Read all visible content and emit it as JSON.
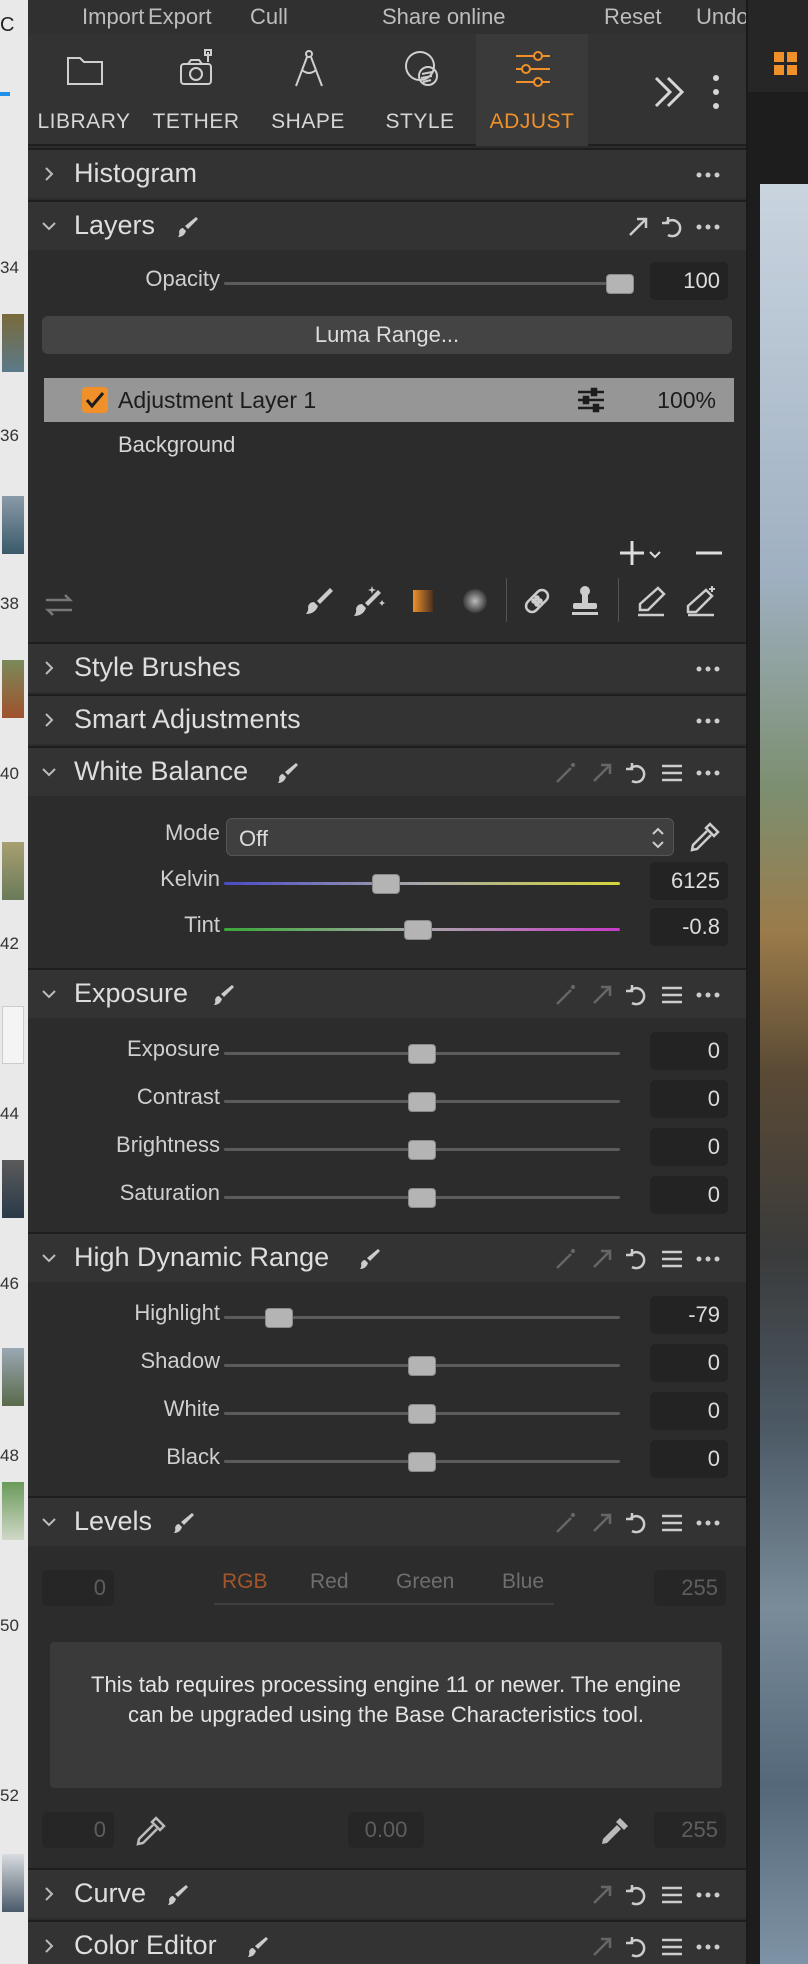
{
  "menu": {
    "import": "Import",
    "export": "Export",
    "cull": "Cull",
    "share": "Share online",
    "reset": "Reset",
    "undo": "Undo/Redo"
  },
  "tabs": [
    {
      "label": "LIBRARY",
      "icon": "folder-icon"
    },
    {
      "label": "TETHER",
      "icon": "camera-icon"
    },
    {
      "label": "SHAPE",
      "icon": "compass-icon"
    },
    {
      "label": "STYLE",
      "icon": "style-circle-icon"
    },
    {
      "label": "ADJUST",
      "icon": "sliders-icon",
      "active": true
    }
  ],
  "accent_color": "#f0902a",
  "filmstrip": {
    "letter": "C",
    "numbers": [
      "34",
      "36",
      "38",
      "40",
      "42",
      "44",
      "46",
      "48",
      "50",
      "52"
    ]
  },
  "histogram": {
    "title": "Histogram"
  },
  "layers": {
    "title": "Layers",
    "opacity_label": "Opacity",
    "opacity_value": "100",
    "opacity_fraction": 1.0,
    "luma_button": "Luma Range...",
    "active_layer": {
      "name": "Adjustment Layer 1",
      "opacity": "100%",
      "checked": true
    },
    "background_layer": "Background"
  },
  "style_brushes": {
    "title": "Style Brushes"
  },
  "smart_adjustments": {
    "title": "Smart Adjustments"
  },
  "white_balance": {
    "title": "White Balance",
    "mode_label": "Mode",
    "mode_value": "Off",
    "kelvin_label": "Kelvin",
    "kelvin_value": "6125",
    "kelvin_fraction": 0.41,
    "tint_label": "Tint",
    "tint_value": "-0.8",
    "tint_fraction": 0.49
  },
  "exposure": {
    "title": "Exposure",
    "rows": [
      {
        "label": "Exposure",
        "value": "0",
        "fraction": 0.5
      },
      {
        "label": "Contrast",
        "value": "0",
        "fraction": 0.5
      },
      {
        "label": "Brightness",
        "value": "0",
        "fraction": 0.5
      },
      {
        "label": "Saturation",
        "value": "0",
        "fraction": 0.5
      }
    ]
  },
  "hdr": {
    "title": "High Dynamic Range",
    "rows": [
      {
        "label": "Highlight",
        "value": "-79",
        "fraction": 0.14
      },
      {
        "label": "Shadow",
        "value": "0",
        "fraction": 0.5
      },
      {
        "label": "White",
        "value": "0",
        "fraction": 0.5
      },
      {
        "label": "Black",
        "value": "0",
        "fraction": 0.5
      }
    ]
  },
  "levels": {
    "title": "Levels",
    "input_low": "0",
    "input_high": "255",
    "channels": [
      "RGB",
      "Red",
      "Green",
      "Blue"
    ],
    "notice": "This tab requires processing engine 11 or newer. The engine can be upgraded using the Base Characteristics tool.",
    "output_low": "0",
    "midpoint": "0.00",
    "output_high": "255"
  },
  "curve": {
    "title": "Curve"
  },
  "color_editor": {
    "title": "Color Editor"
  }
}
